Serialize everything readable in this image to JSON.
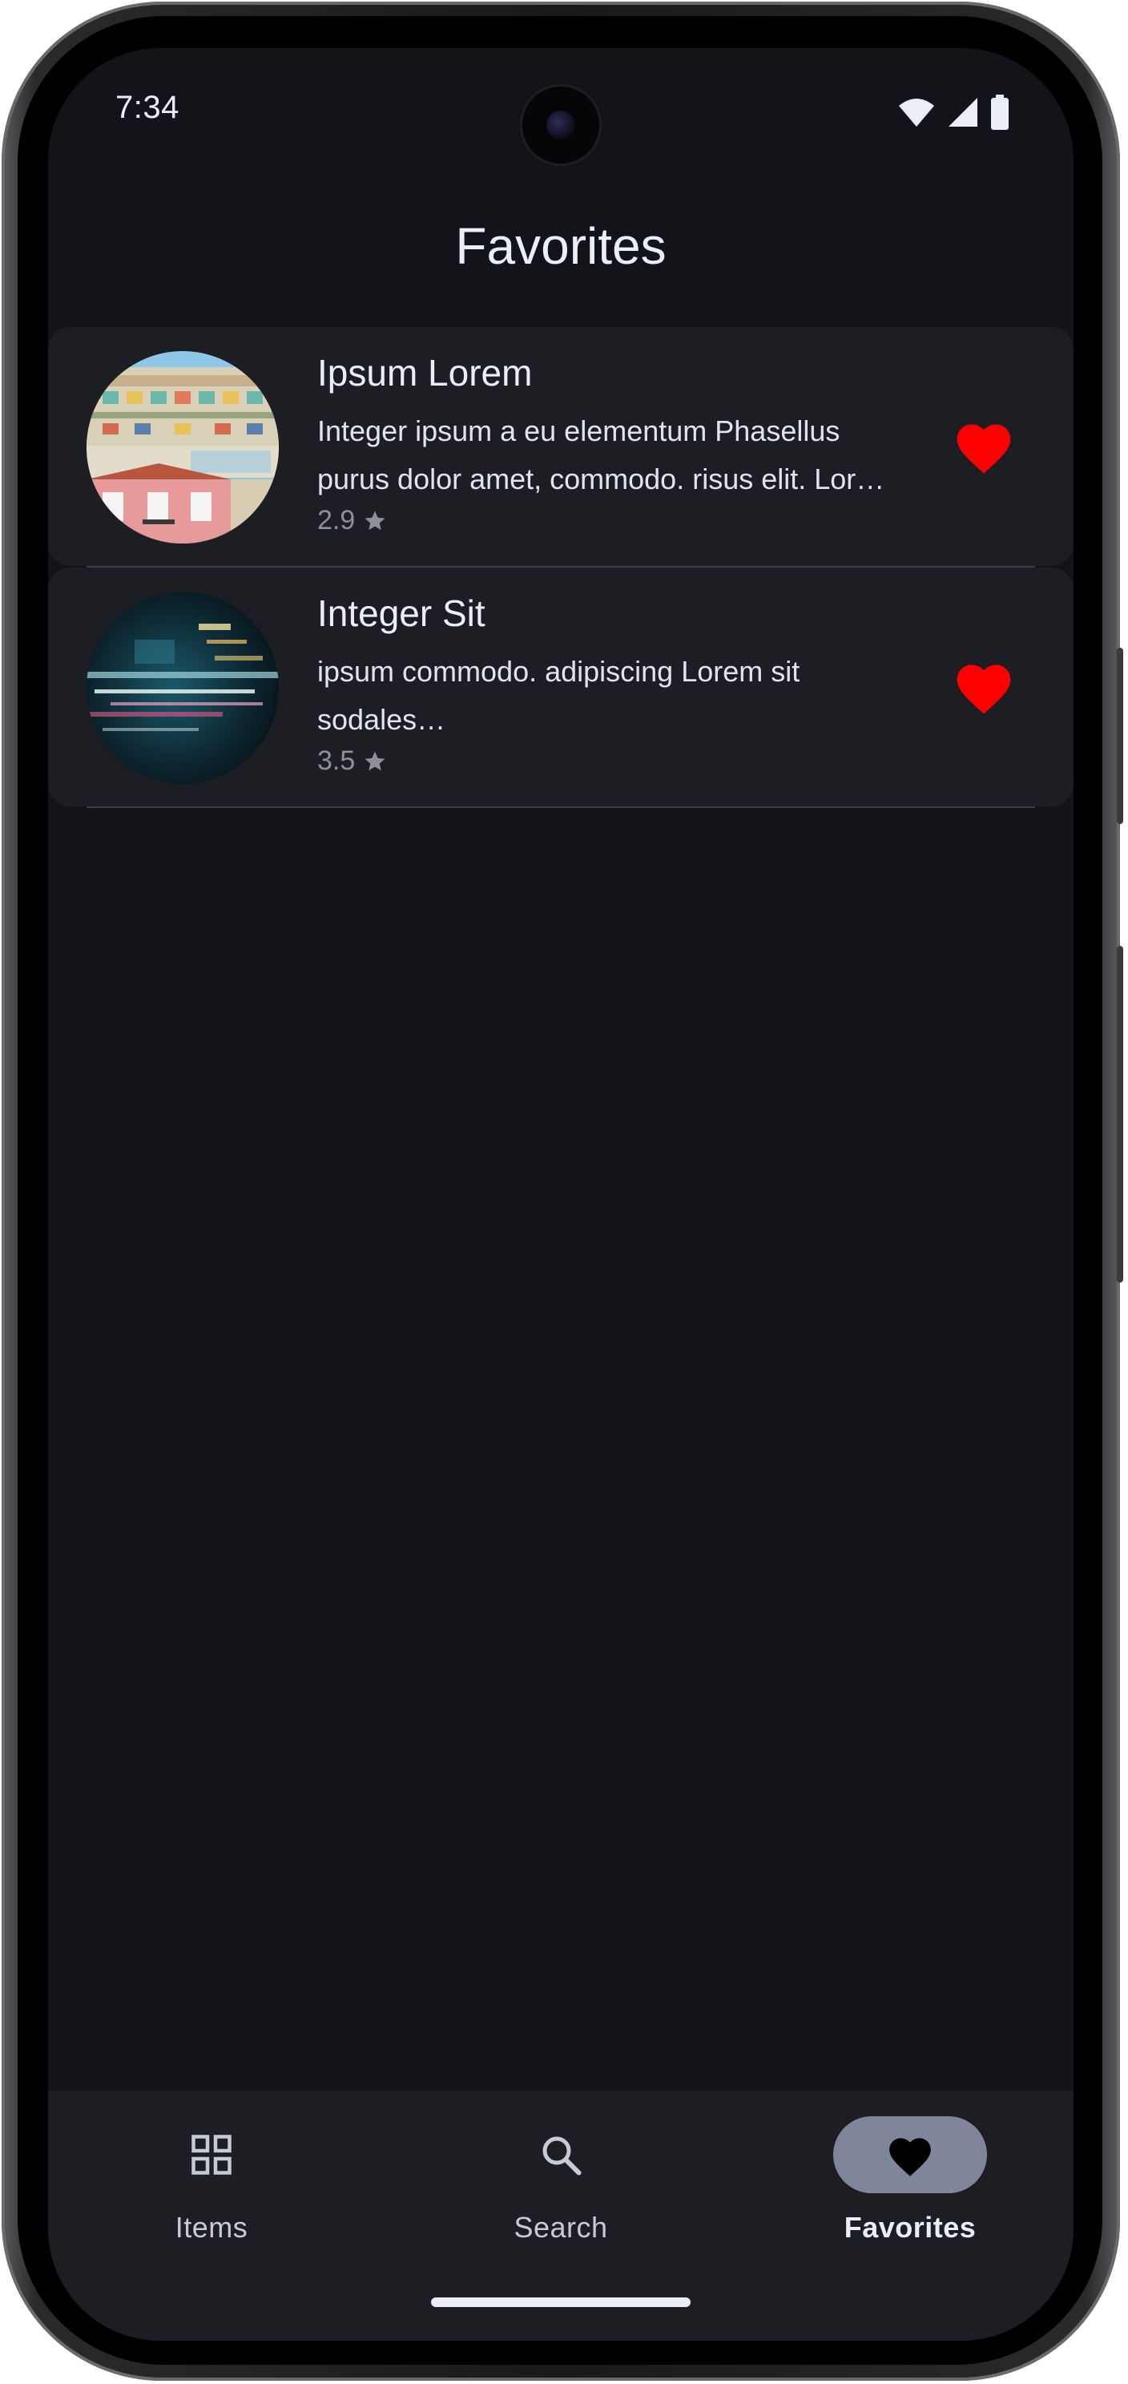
{
  "status_bar": {
    "time": "7:34",
    "icons": [
      "wifi-icon",
      "signal-icon",
      "battery-icon"
    ]
  },
  "app_bar": {
    "title": "Favorites"
  },
  "favorites": [
    {
      "title": "Ipsum Lorem",
      "description": "Integer ipsum a eu elementum Phasellus purus dolor amet, commodo. risus elit. Lor…",
      "rating": "2.9",
      "favorited": true,
      "image": "building-photo"
    },
    {
      "title": "Integer Sit",
      "description": "ipsum commodo. adipiscing Lorem sit sodales…",
      "rating": "3.5",
      "favorited": true,
      "image": "light-trails-photo"
    }
  ],
  "bottom_nav": {
    "items": [
      {
        "label": "Items",
        "icon": "grid-icon",
        "active": false
      },
      {
        "label": "Search",
        "icon": "search-icon",
        "active": false
      },
      {
        "label": "Favorites",
        "icon": "heart-icon",
        "active": true
      }
    ]
  },
  "colors": {
    "background": "#13141a",
    "surface": "#1d1e24",
    "heart": "#ff0000",
    "nav_active_indicator": "#7f869b",
    "text_primary": "#eceef5",
    "text_secondary": "#8e9099"
  }
}
